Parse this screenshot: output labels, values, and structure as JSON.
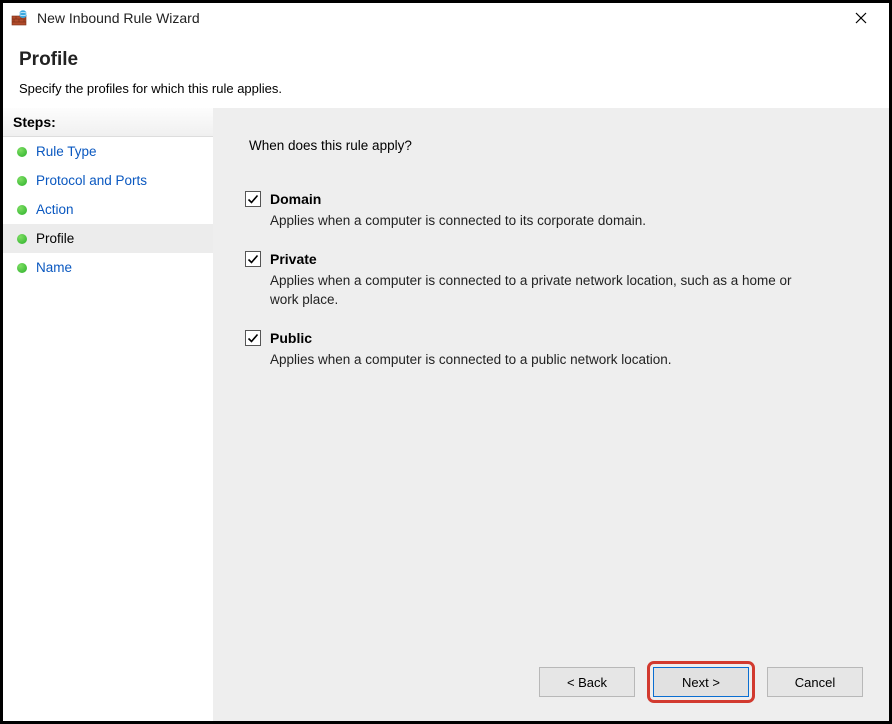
{
  "window": {
    "title": "New Inbound Rule Wizard"
  },
  "header": {
    "title": "Profile",
    "subtitle": "Specify the profiles for which this rule applies."
  },
  "sidebar": {
    "steps_label": "Steps:",
    "items": [
      {
        "label": "Rule Type",
        "current": false
      },
      {
        "label": "Protocol and Ports",
        "current": false
      },
      {
        "label": "Action",
        "current": false
      },
      {
        "label": "Profile",
        "current": true
      },
      {
        "label": "Name",
        "current": false
      }
    ]
  },
  "main": {
    "prompt": "When does this rule apply?",
    "profiles": [
      {
        "label": "Domain",
        "checked": true,
        "desc": "Applies when a computer is connected to its corporate domain."
      },
      {
        "label": "Private",
        "checked": true,
        "desc": "Applies when a computer is connected to a private network location, such as a home or work place."
      },
      {
        "label": "Public",
        "checked": true,
        "desc": "Applies when a computer is connected to a public network location."
      }
    ]
  },
  "buttons": {
    "back": "< Back",
    "next": "Next >",
    "cancel": "Cancel"
  }
}
